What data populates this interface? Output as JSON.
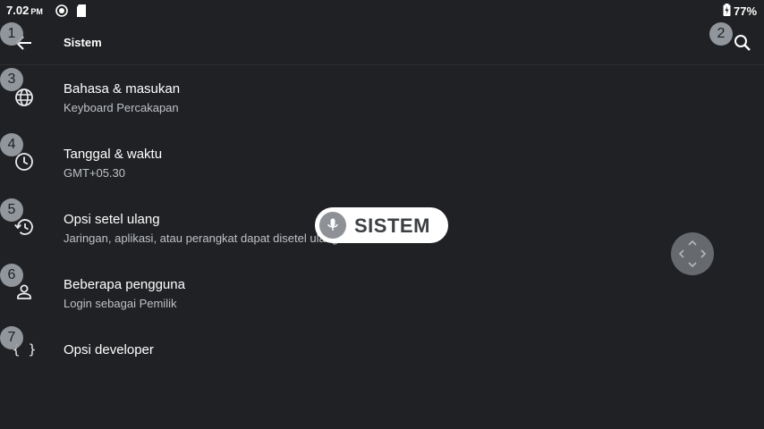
{
  "status_bar": {
    "time": "7.02",
    "ampm": "PM",
    "battery": "77%"
  },
  "app_bar": {
    "title": "Sistem"
  },
  "items": [
    {
      "title": "Bahasa & masukan",
      "subtitle": "Keyboard Percakapan",
      "icon": "globe-icon"
    },
    {
      "title": "Tanggal & waktu",
      "subtitle": "GMT+05.30",
      "icon": "clock-icon"
    },
    {
      "title": "Opsi setel ulang",
      "subtitle": "Jaringan, aplikasi, atau perangkat dapat disetel ulang",
      "icon": "history-icon"
    },
    {
      "title": "Beberapa pengguna",
      "subtitle": "Login sebagai Pemilik",
      "icon": "person-icon"
    },
    {
      "title": "Opsi developer",
      "subtitle": "",
      "icon": "braces-icon"
    }
  ],
  "badges": [
    "1",
    "2",
    "3",
    "4",
    "5",
    "6",
    "7"
  ],
  "voice_overlay": {
    "text": "SISTEM"
  },
  "colors": {
    "background": "#202124",
    "text_primary": "#ffffff",
    "text_secondary": "#bdc1c6",
    "badge": "#9aa0a6"
  }
}
